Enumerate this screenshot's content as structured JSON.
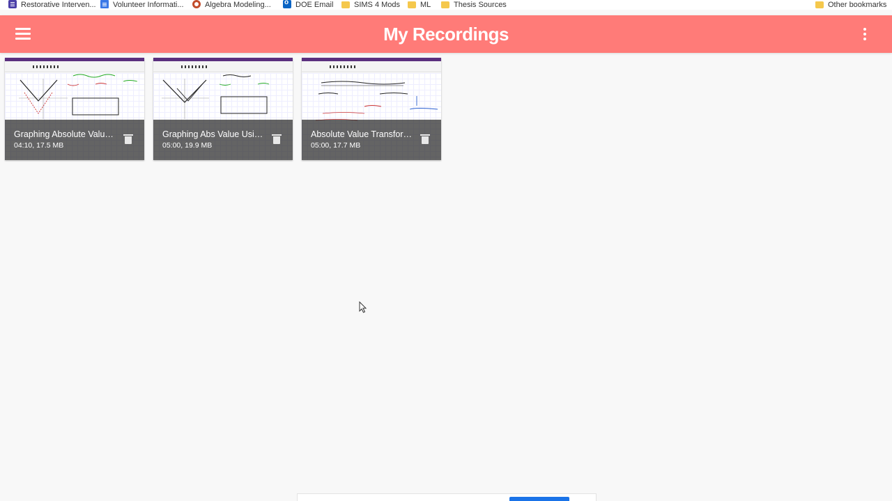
{
  "bookmarks": [
    {
      "icon": "list-icon",
      "label": "Restorative Interven..."
    },
    {
      "icon": "doc-icon",
      "label": "Volunteer Informati..."
    },
    {
      "icon": "gear-icon",
      "label": "Algebra Modeling..."
    },
    {
      "icon": "outlook-icon",
      "label": "DOE Email"
    },
    {
      "icon": "folder-icon",
      "label": "SIMS 4 Mods"
    },
    {
      "icon": "folder-icon",
      "label": "ML"
    },
    {
      "icon": "folder-icon",
      "label": "Thesis Sources"
    }
  ],
  "other_bookmarks": {
    "icon": "folder-icon",
    "label": "Other bookmarks"
  },
  "header": {
    "title": "My Recordings",
    "menu_icon": "hamburger-menu-icon",
    "more_icon": "more-vert-icon",
    "color": "#ff7b78"
  },
  "recordings": [
    {
      "title": "Graphing Absolute Value Functions",
      "meta": "04:10, 17.5 MB"
    },
    {
      "title": "Graphing Abs Value Using Transformations",
      "meta": "05:00, 19.9 MB"
    },
    {
      "title": "Absolute Value Transformations",
      "meta": "05:00, 17.7 MB"
    }
  ],
  "upload_progress": 0.2
}
